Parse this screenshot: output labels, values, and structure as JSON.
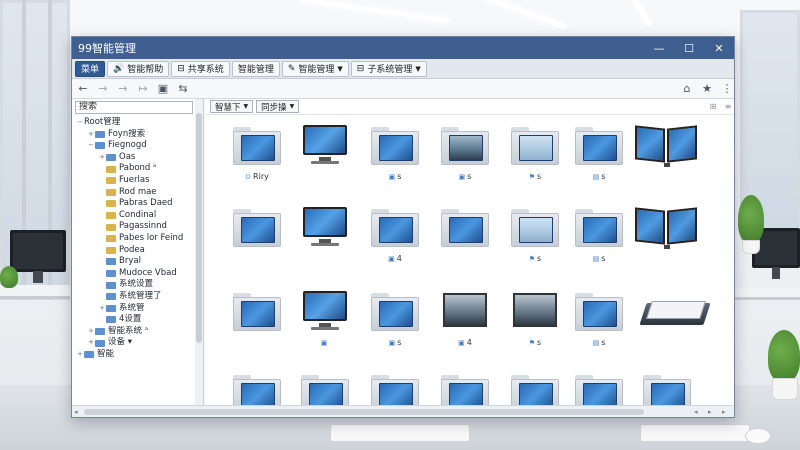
{
  "window": {
    "title": "99智能管理",
    "min_glyph": "—",
    "max_glyph": "☐",
    "close_glyph": "✕"
  },
  "menubar": [
    {
      "label": "菜单",
      "icon": "",
      "dropdown": false,
      "primary": true
    },
    {
      "label": "智能帮助",
      "icon": "🔊",
      "dropdown": false,
      "primary": false
    },
    {
      "label": "共享系统",
      "icon": "⊟",
      "dropdown": false,
      "primary": false
    },
    {
      "label": "智能管理",
      "icon": "",
      "dropdown": false,
      "primary": false
    },
    {
      "label": "智能管理",
      "icon": "✎",
      "dropdown": true,
      "primary": false
    },
    {
      "label": "子系统管理",
      "icon": "⊟",
      "dropdown": true,
      "primary": false
    }
  ],
  "nav": {
    "back": "←",
    "forward": "→",
    "up": "→",
    "share": "↦",
    "save": "▣",
    "link": "⇆",
    "home": "⌂",
    "star": "★",
    "menu": "⋮"
  },
  "tree": {
    "search_value": "搜索",
    "nodes": [
      {
        "label": "Root管理",
        "level": 0,
        "toggle": "−",
        "folder": "none"
      },
      {
        "label": "Foyn搜索",
        "level": 1,
        "toggle": "+",
        "folder": "blue"
      },
      {
        "label": "Fiegnogd",
        "level": 1,
        "toggle": "−",
        "folder": "blue"
      },
      {
        "label": "Oas",
        "level": 2,
        "toggle": "+",
        "folder": "blue"
      },
      {
        "label": "Pabond ᵃ",
        "level": 2,
        "toggle": "",
        "folder": "yel"
      },
      {
        "label": "Fuerlas",
        "level": 2,
        "toggle": "",
        "folder": "yel"
      },
      {
        "label": "Rod mae",
        "level": 2,
        "toggle": "",
        "folder": "yel"
      },
      {
        "label": "Pabras Daed",
        "level": 2,
        "toggle": "",
        "folder": "yel"
      },
      {
        "label": "Condinal",
        "level": 2,
        "toggle": "",
        "folder": "yel"
      },
      {
        "label": "Pagassinnd",
        "level": 2,
        "toggle": "",
        "folder": "yel"
      },
      {
        "label": "Pabes lor Feind",
        "level": 2,
        "toggle": "",
        "folder": "yel"
      },
      {
        "label": "Podea",
        "level": 2,
        "toggle": "",
        "folder": "yel"
      },
      {
        "label": "Bryal",
        "level": 2,
        "toggle": "",
        "folder": "blue"
      },
      {
        "label": "Mudoce Vbad",
        "level": 2,
        "toggle": "",
        "folder": "blue"
      },
      {
        "label": "系统设置",
        "level": 2,
        "toggle": "",
        "folder": "blue"
      },
      {
        "label": "系统管理了",
        "level": 2,
        "toggle": "",
        "folder": "blue"
      },
      {
        "label": "系统管",
        "level": 2,
        "toggle": "+",
        "folder": "blue"
      },
      {
        "label": "4设置",
        "level": 2,
        "toggle": "",
        "folder": "blue"
      },
      {
        "label": "智能系统 ᵃ",
        "level": 1,
        "toggle": "+",
        "folder": "blue"
      },
      {
        "label": "设备 ▾",
        "level": 1,
        "toggle": "+",
        "folder": "blue"
      },
      {
        "label": "智能",
        "level": 0,
        "toggle": "+",
        "folder": "blue"
      }
    ]
  },
  "content_toolbar": {
    "sort_label": "智慧下",
    "view_label": "同步操",
    "grid_glyph": "⊞",
    "list_glyph": "≡"
  },
  "items": [
    {
      "kind": "folder",
      "screen": "win",
      "caption": "Riry",
      "cap_icon": "⊙"
    },
    {
      "kind": "monitor",
      "caption": "",
      "cap_icon": ""
    },
    {
      "kind": "folder",
      "screen": "win",
      "caption": "s",
      "cap_icon": "▣"
    },
    {
      "kind": "folder",
      "screen": "photo",
      "caption": "s",
      "cap_icon": "▣"
    },
    {
      "kind": "folder",
      "screen": "sky",
      "caption": "s",
      "cap_icon": "⚑"
    },
    {
      "kind": "folder",
      "screen": "win",
      "caption": "s",
      "cap_icon": "▤"
    },
    {
      "kind": "book",
      "caption": "",
      "cap_icon": ""
    },
    {
      "kind": "folder",
      "screen": "win",
      "caption": "",
      "cap_icon": ""
    },
    {
      "kind": "monitor",
      "caption": "",
      "cap_icon": ""
    },
    {
      "kind": "folder",
      "screen": "win",
      "caption": "4",
      "cap_icon": "▣"
    },
    {
      "kind": "folder",
      "screen": "win",
      "caption": "",
      "cap_icon": ""
    },
    {
      "kind": "folder",
      "screen": "sky",
      "caption": "s",
      "cap_icon": "⚑"
    },
    {
      "kind": "folder",
      "screen": "win",
      "caption": "s",
      "cap_icon": "▤"
    },
    {
      "kind": "book",
      "caption": "",
      "cap_icon": ""
    },
    {
      "kind": "folder",
      "screen": "win",
      "caption": "",
      "cap_icon": ""
    },
    {
      "kind": "monitor",
      "caption": "",
      "cap_icon": "▣"
    },
    {
      "kind": "folder",
      "screen": "win",
      "caption": "s",
      "cap_icon": "▣"
    },
    {
      "kind": "photo",
      "caption": "4",
      "cap_icon": "▣"
    },
    {
      "kind": "photo",
      "caption": "s",
      "cap_icon": "⚑"
    },
    {
      "kind": "folder",
      "screen": "win",
      "caption": "s",
      "cap_icon": "▤"
    },
    {
      "kind": "open",
      "caption": "",
      "cap_icon": ""
    },
    {
      "kind": "folder",
      "screen": "win",
      "caption": "",
      "cap_icon": ""
    },
    {
      "kind": "folder",
      "screen": "win",
      "caption": "",
      "cap_icon": ""
    },
    {
      "kind": "folder",
      "screen": "win",
      "caption": "",
      "cap_icon": ""
    },
    {
      "kind": "folder",
      "screen": "win",
      "caption": "",
      "cap_icon": ""
    },
    {
      "kind": "folder",
      "screen": "win",
      "caption": "",
      "cap_icon": ""
    },
    {
      "kind": "folder",
      "screen": "win",
      "caption": "",
      "cap_icon": ""
    },
    {
      "kind": "folder",
      "screen": "win",
      "caption": "",
      "cap_icon": ""
    }
  ],
  "colors": {
    "titlebar": "#3e5f8f",
    "accent": "#2f5a95",
    "folder_blue": "#5e8fd1",
    "folder_yellow": "#d9b34c"
  }
}
